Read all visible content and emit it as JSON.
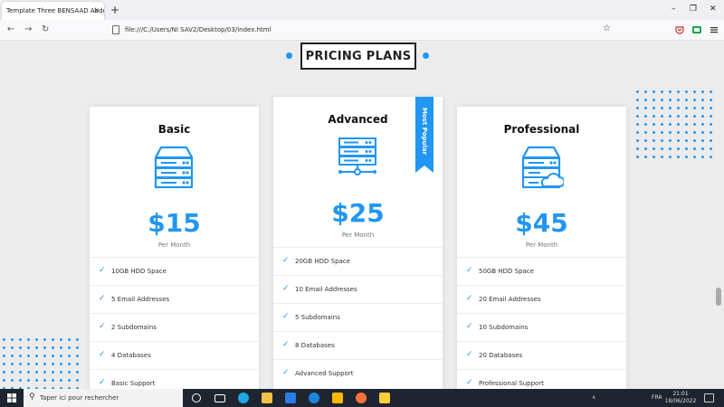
{
  "browser": {
    "tab_title": "Template Three BENSAAD Abdelhak",
    "tab_close": "×",
    "new_tab": "+",
    "url": "file:///C:/Users/NI SAV2/Desktop/03/index.html",
    "win_min": "–",
    "win_max": "❐",
    "win_close": "✕",
    "back": "←",
    "forward": "→",
    "reload": "↻",
    "star": "☆"
  },
  "page": {
    "section_title": "PRICING PLANS",
    "plans": [
      {
        "name": "Basic",
        "price": "$15",
        "period": "Per Month",
        "features": [
          "10GB HDD Space",
          "5 Email Addresses",
          "2 Subdomains",
          "4 Databases",
          "Basic Support"
        ]
      },
      {
        "name": "Advanced",
        "price": "$25",
        "period": "Per Month",
        "badge": "Most Popular",
        "features": [
          "20GB HDD Space",
          "10 Email Addresses",
          "5 Subdomains",
          "8 Databases",
          "Advanced Support"
        ]
      },
      {
        "name": "Professional",
        "price": "$45",
        "period": "Per Month",
        "features": [
          "50GB HDD Space",
          "20 Email Addresses",
          "10 Subdomains",
          "20 Databases",
          "Professional Support"
        ]
      }
    ]
  },
  "taskbar": {
    "search_placeholder": "Taper ici pour rechercher",
    "language": "FRA",
    "time": "21:01",
    "date": "18/06/2022"
  },
  "colors": {
    "accent": "#2196f3",
    "page_bg": "#ececec",
    "taskbar": "#1f2530"
  }
}
